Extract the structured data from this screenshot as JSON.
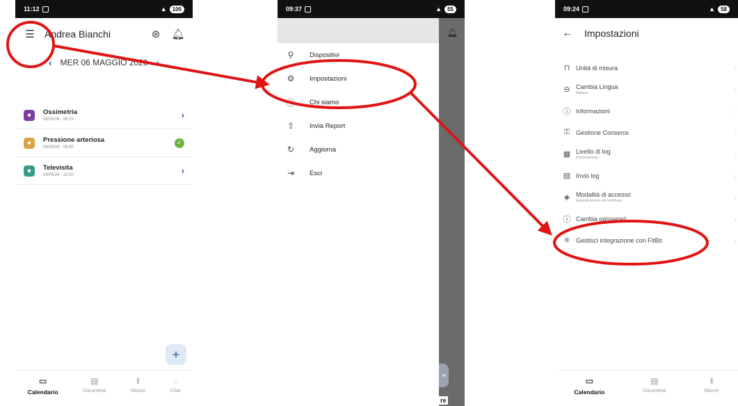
{
  "colors": {
    "annotation": "#e01414",
    "accent": "#2a5db0",
    "done": "#6db33f"
  },
  "phone1": {
    "status": {
      "time": "11:12",
      "battery": "100"
    },
    "appbar": {
      "menu_icon": "hamburger-icon",
      "title": "Andrea Bianchi",
      "profile_icon": "account-icon",
      "bell_icon": "bell-icon"
    },
    "date": {
      "prev": "‹",
      "label": "MER 06 MAGGIO 2026",
      "next": "›"
    },
    "items": [
      {
        "title": "Ossimetria",
        "sub": "06/05/26 - 08:15",
        "icon": "oximeter-icon",
        "tile_color": "#7b3fa0",
        "action": "chevron"
      },
      {
        "title": "Pressione arteriosa",
        "sub": "06/05/26 - 09:30",
        "icon": "pressure-icon",
        "tile_color": "#d9a441",
        "action": "check"
      },
      {
        "title": "Televisita",
        "sub": "06/05/26 - 10:00",
        "icon": "televisit-icon",
        "tile_color": "#3a9a8a",
        "action": "chevron"
      }
    ],
    "fab": "+",
    "nav": [
      {
        "label": "Calendario",
        "icon": "calendar-icon",
        "active": true
      },
      {
        "label": "Documenti",
        "icon": "documents-icon",
        "active": false
      },
      {
        "label": "Misure",
        "icon": "thermometer-icon",
        "active": false
      },
      {
        "label": "Chat",
        "icon": "chat-icon",
        "active": false
      }
    ]
  },
  "phone2": {
    "status": {
      "time": "09:37",
      "battery": "55"
    },
    "menu": [
      {
        "label": "Dispositivi",
        "icon": "devices-icon"
      },
      {
        "label": "Impostazioni",
        "icon": "gear-icon"
      },
      {
        "label": "Chi siamo",
        "icon": "info-icon"
      },
      {
        "label": "Invia Report",
        "icon": "upload-icon"
      },
      {
        "label": "Aggiorna",
        "icon": "refresh-icon"
      },
      {
        "label": "Esci",
        "icon": "logout-icon"
      }
    ],
    "fab": "+",
    "bottom_fragment": "re"
  },
  "phone3": {
    "status": {
      "time": "09:24",
      "battery": "58"
    },
    "title": "Impostazioni",
    "back_icon": "back-arrow-icon",
    "items": [
      {
        "title": "Unità di misura",
        "sub": "",
        "icon": "ruler-icon"
      },
      {
        "title": "Cambia Lingua",
        "sub": "Italiano",
        "icon": "language-icon"
      },
      {
        "title": "Informazioni",
        "sub": "",
        "icon": "info-icon"
      },
      {
        "title": "Gestione Consensi",
        "sub": "",
        "icon": "consent-icon"
      },
      {
        "title": "Livello di log",
        "sub": "Informazione",
        "icon": "log-level-icon"
      },
      {
        "title": "Invio log",
        "sub": "",
        "icon": "send-log-icon"
      },
      {
        "title": "Modalità di accesso",
        "sub": "Autenticazione del telefono",
        "icon": "fingerprint-icon"
      },
      {
        "title": "Cambia password",
        "sub": "",
        "icon": "password-icon"
      },
      {
        "title": "Gestisci integrazione con FitBit",
        "sub": "",
        "icon": "fitbit-icon"
      }
    ],
    "nav": [
      {
        "label": "Calendario",
        "icon": "calendar-icon",
        "active": true
      },
      {
        "label": "Documenti",
        "icon": "documents-icon",
        "active": false
      },
      {
        "label": "Misure",
        "icon": "thermometer-icon",
        "active": false
      }
    ]
  }
}
